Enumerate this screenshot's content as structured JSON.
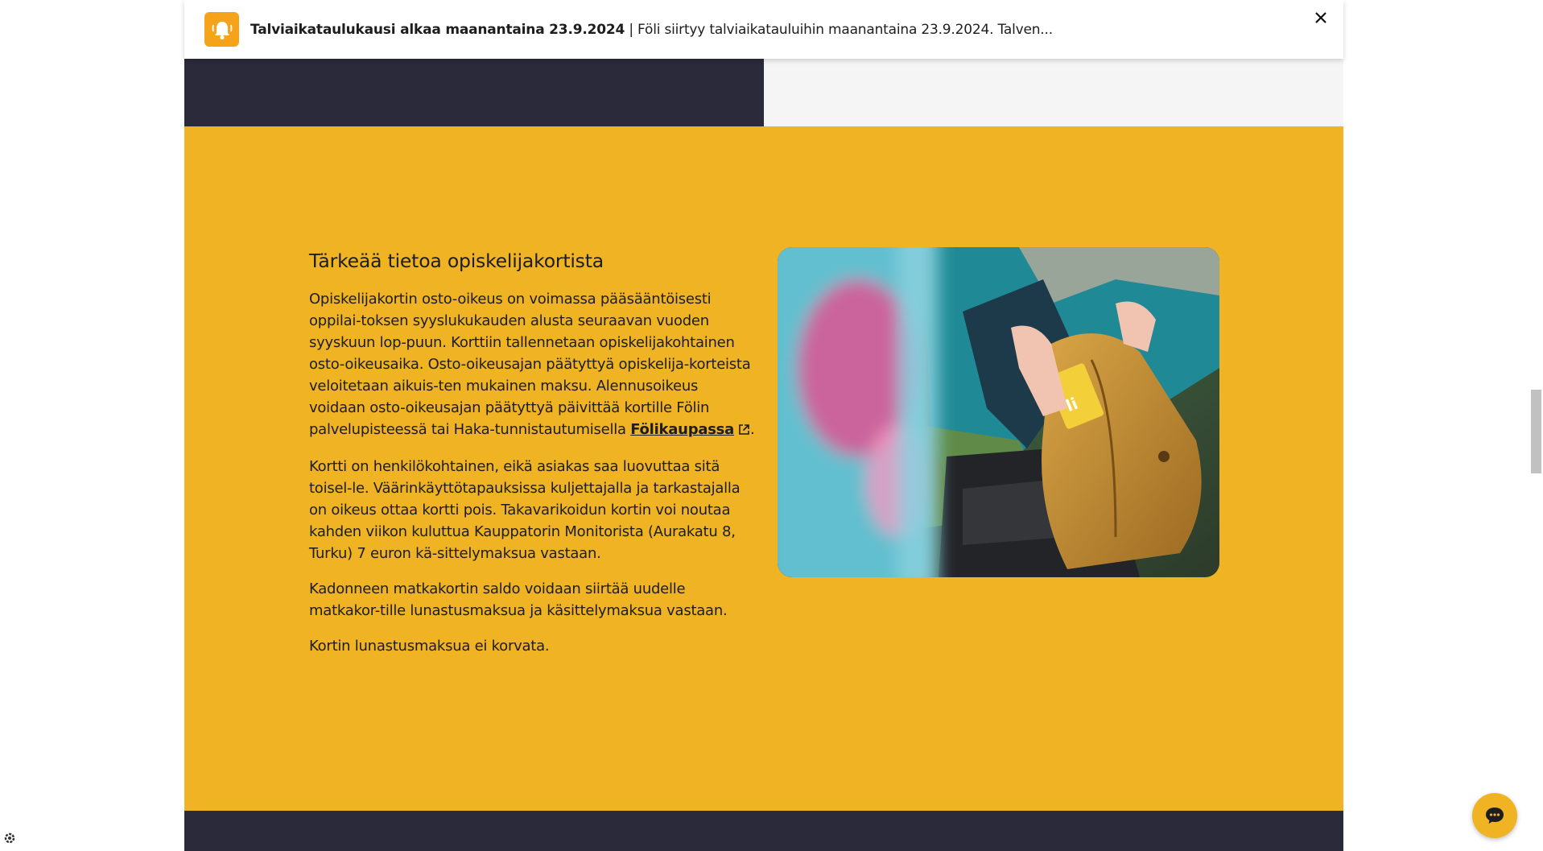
{
  "notification": {
    "title": "Talviaikataulukausi alkaa maanantaina 23.9.2024",
    "separator": " | ",
    "body": "Föli siirtyy talviaikatauluihin maanantaina 23.9.2024.  Talven...",
    "icon": "bell-icon",
    "close_icon": "close-icon"
  },
  "article": {
    "heading": "Tärkeää tietoa opiskelijakortista",
    "p1_before_link": "Opiskelijakortin osto-oikeus on voimassa pääsääntöisesti oppilai-toksen syyslukukauden alusta seuraavan vuoden syyskuun lop-puun. Korttiin tallennetaan opiskelijakohtainen osto-oikeusaika. Osto-oikeusajan päätyttyä opiskelija-korteista veloitetaan aikuis-ten mukainen maksu. Alennusoikeus voidaan osto-oikeusajan päätyttyä päivittää kortille Fölin palvelupisteessä tai Haka-tunnistautumisella ",
    "p1_link": "Fölikaupassa",
    "p1_after_link": ".",
    "p2": "Kortti on henkilökohtainen, eikä asiakas saa luovuttaa sitä toisel-le. Väärinkäyttötapauksissa kuljettajalla ja tarkastajalla on oikeus ottaa kortti pois. Takavarikoidun kortin voi noutaa kahden viikon kuluttua Kauppatorin Monitorista (Aurakatu 8, Turku) 7 euron kä-sittelymaksua vastaan.",
    "p3": "Kadonneen matkakortin saldo voidaan siirtää uudelle matkakor-tille lunastusmaksua ja käsittelymaksua vastaan.",
    "p4": "Kortin lunastusmaksua ei korvata."
  },
  "colors": {
    "accent_yellow": "#efb324",
    "dark_navy": "#2b2a3a",
    "bell_orange": "#f4a31b"
  }
}
